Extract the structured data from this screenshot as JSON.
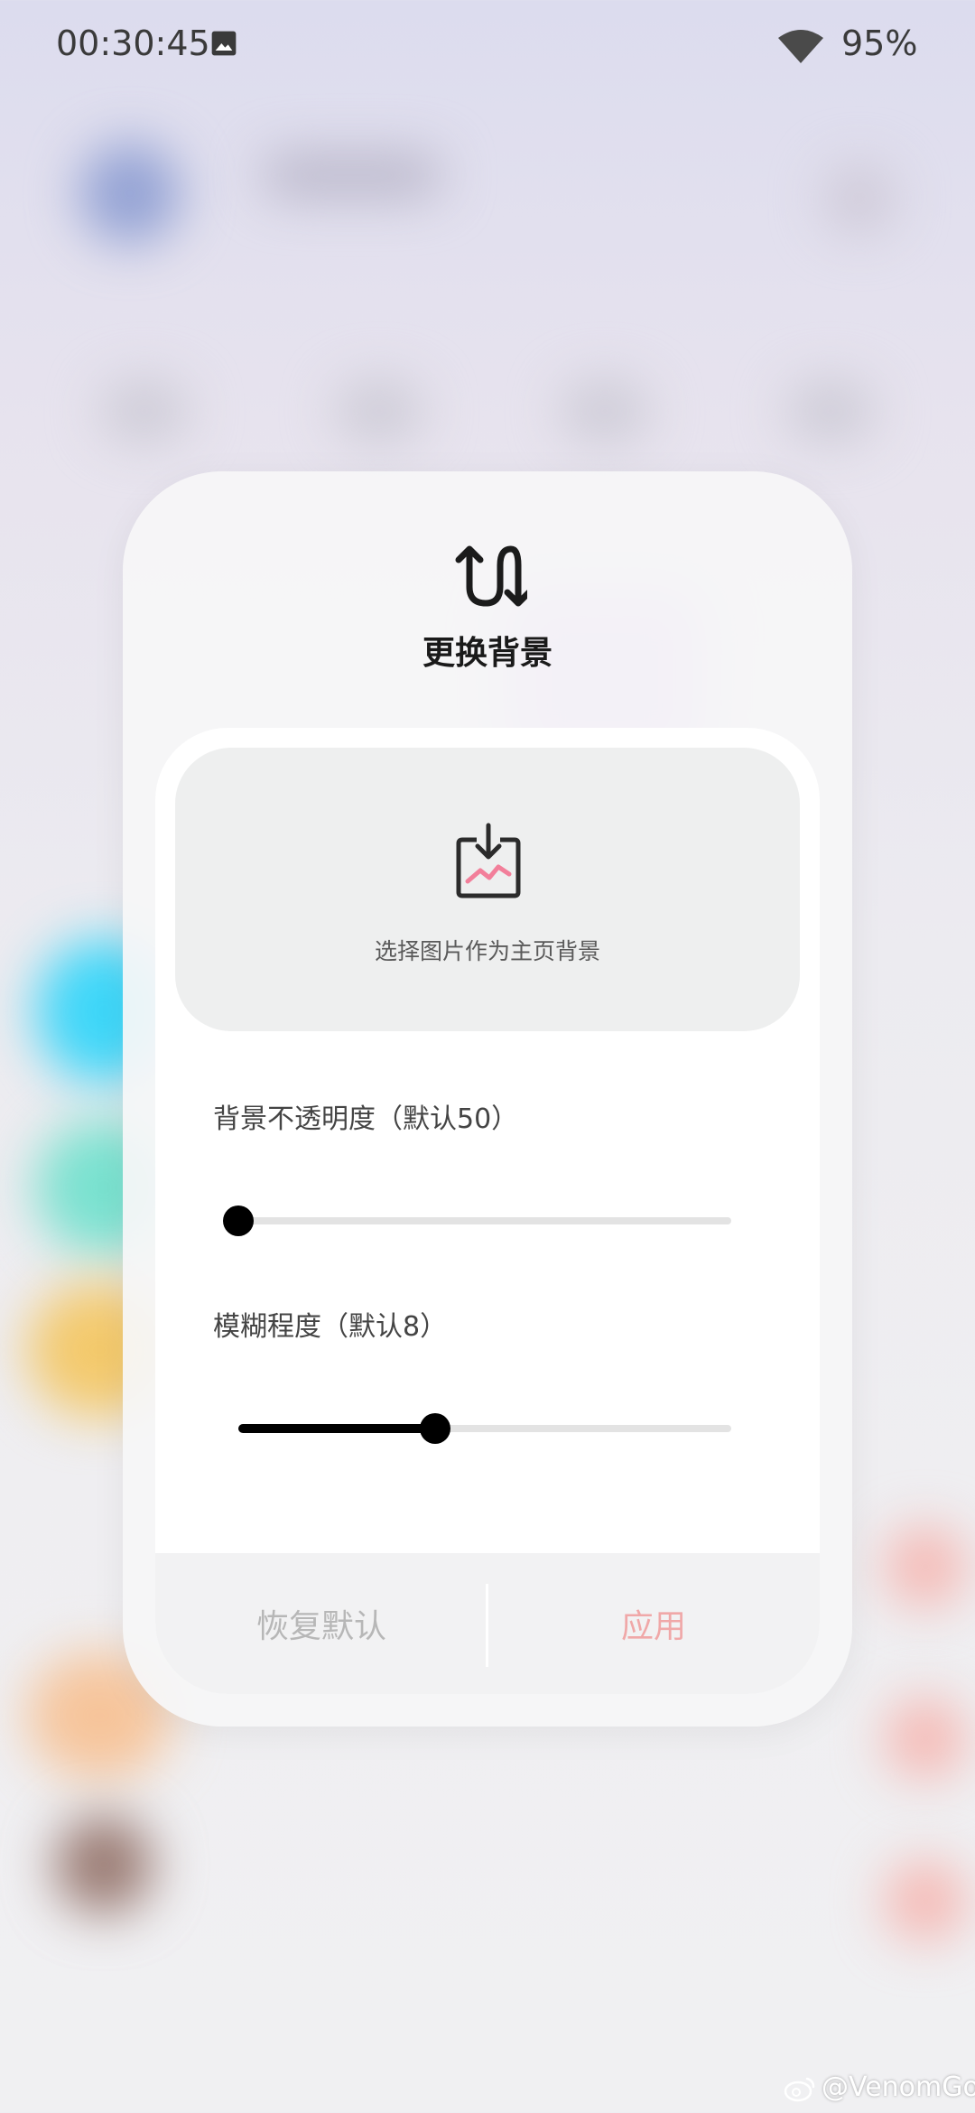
{
  "status_bar": {
    "time": "00:30:45",
    "battery": "95%",
    "icons": [
      "gallery-icon",
      "wifi-icon"
    ]
  },
  "dialog": {
    "title": "更换背景",
    "header_icon": "swap-icon",
    "picker": {
      "icon": "image-download-icon",
      "label": "选择图片作为主页背景"
    },
    "opacity_slider": {
      "label": "背景不透明度（默认50）",
      "value_fraction": 0
    },
    "blur_slider": {
      "label": "模糊程度（默认8）",
      "value_fraction": 0.4
    },
    "buttons": {
      "reset": "恢复默认",
      "apply": "应用"
    }
  },
  "watermark": "@VenomGo",
  "colors": {
    "accent_pink": "#f27f9a",
    "apply_text": "#f0a8a8",
    "reset_text": "#b7b7b7"
  }
}
